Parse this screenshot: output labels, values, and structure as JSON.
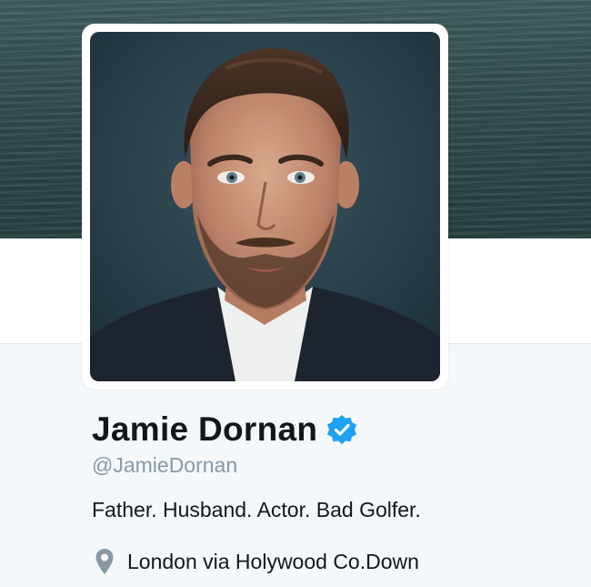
{
  "profile": {
    "name": "Jamie Dornan",
    "handle": "@JamieDornan",
    "bio": "Father. Husband. Actor. Bad Golfer.",
    "location": "London via Holywood Co.Down",
    "verified": true
  },
  "icons": {
    "verified": "verified-badge-icon",
    "location": "map-pin-icon"
  },
  "colors": {
    "name": "#14171a",
    "handle": "#8899a6",
    "verified_badge": "#1da1f2",
    "background": "#f5f8fa"
  }
}
